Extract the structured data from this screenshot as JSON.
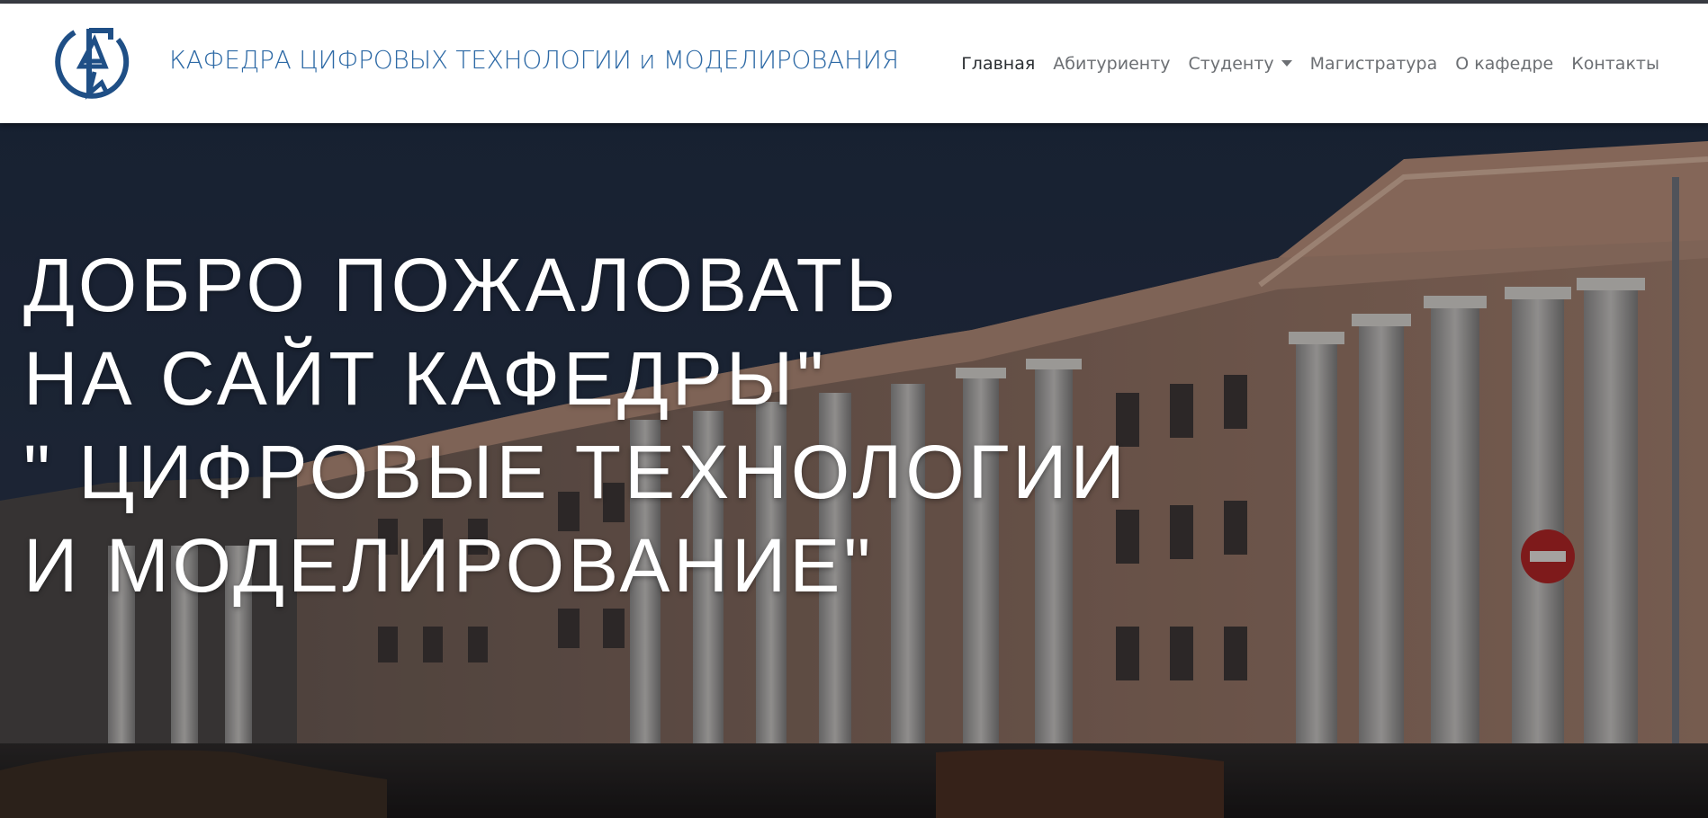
{
  "brand": {
    "title": "КАФЕДРА ЦИФРОВЫХ ТЕХНОЛОГИИ и МОДЕЛИРОВАНИЯ",
    "logo_icon": "department-emblem-icon"
  },
  "nav": {
    "items": [
      {
        "label": "Главная",
        "active": true
      },
      {
        "label": "Абитуриенту"
      },
      {
        "label": "Студенту",
        "dropdown": true
      },
      {
        "label": "Магистратура"
      },
      {
        "label": "О кафедре"
      },
      {
        "label": "Контакты"
      }
    ]
  },
  "hero": {
    "lines": [
      "ДОБРО ПОЖАЛОВАТЬ",
      "НА САЙТ КАФЕДРЫ\"",
      "\" ЦИФРОВЫЕ ТЕХНОЛОГИИ",
      "И МОДЕЛИРОВАНИЕ\""
    ],
    "background": "university-building-photo"
  },
  "colors": {
    "brand": "#2e6aa6",
    "logo": "#1f4f86",
    "nav_text": "#6c6f73",
    "nav_active": "#2b2f33"
  }
}
